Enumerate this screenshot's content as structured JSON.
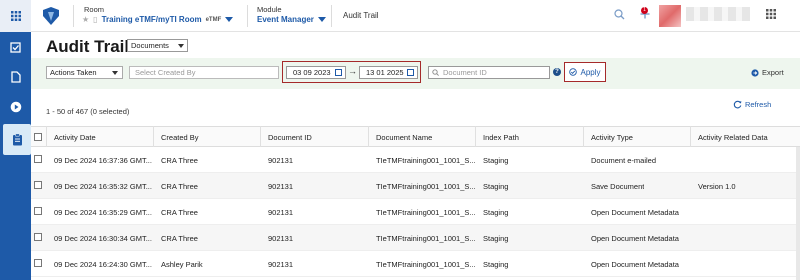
{
  "header": {
    "room_label": "Room",
    "room_name": "Training eTMF/myTI Room",
    "room_tag": "eTMF",
    "module_label": "Module",
    "module_name": "Event Manager",
    "current_page": "Audit Trail",
    "notification_count": "1"
  },
  "page": {
    "title": "Audit Trail",
    "view_select": "Documents"
  },
  "filters": {
    "actions_taken": "Actions Taken",
    "created_by_placeholder": "Select Created By",
    "date_from": "03 09 2023",
    "date_arrow": "→",
    "date_to": "13 01 2025",
    "document_id_placeholder": "Document ID",
    "help": "?",
    "apply_label": "Apply",
    "export_label": "Export"
  },
  "summary": {
    "count_text": "1 - 50 of 467 (0 selected)",
    "refresh_label": "Refresh"
  },
  "table": {
    "columns": [
      "Activity Date",
      "Created By",
      "Document ID",
      "Document Name",
      "Index Path",
      "Activity Type",
      "Activity Related Data"
    ],
    "rows": [
      [
        "09 Dec 2024 16:37:36 GMT...",
        "CRA Three",
        "902131",
        "TIeTMFtraining001_1001_S...",
        "Staging",
        "Document e-mailed",
        ""
      ],
      [
        "09 Dec 2024 16:35:32 GMT...",
        "CRA Three",
        "902131",
        "TIeTMFtraining001_1001_S...",
        "Staging",
        "Save Document",
        "Version 1.0"
      ],
      [
        "09 Dec 2024 16:35:29 GMT...",
        "CRA Three",
        "902131",
        "TIeTMFtraining001_1001_S...",
        "Staging",
        "Open Document Metadata",
        ""
      ],
      [
        "09 Dec 2024 16:30:34 GMT...",
        "CRA Three",
        "902131",
        "TIeTMFtraining001_1001_S...",
        "Staging",
        "Open Document Metadata",
        ""
      ],
      [
        "09 Dec 2024 16:24:30 GMT...",
        "Ashley Parik",
        "902131",
        "TIeTMFtraining001_1001_S...",
        "Staging",
        "Open Document Metadata",
        ""
      ]
    ]
  },
  "colors": {
    "rail": "#1e5aa8",
    "accent": "#1e5aa8",
    "highlight_border": "#a52a2a",
    "filter_bar": "#eef6ee"
  }
}
